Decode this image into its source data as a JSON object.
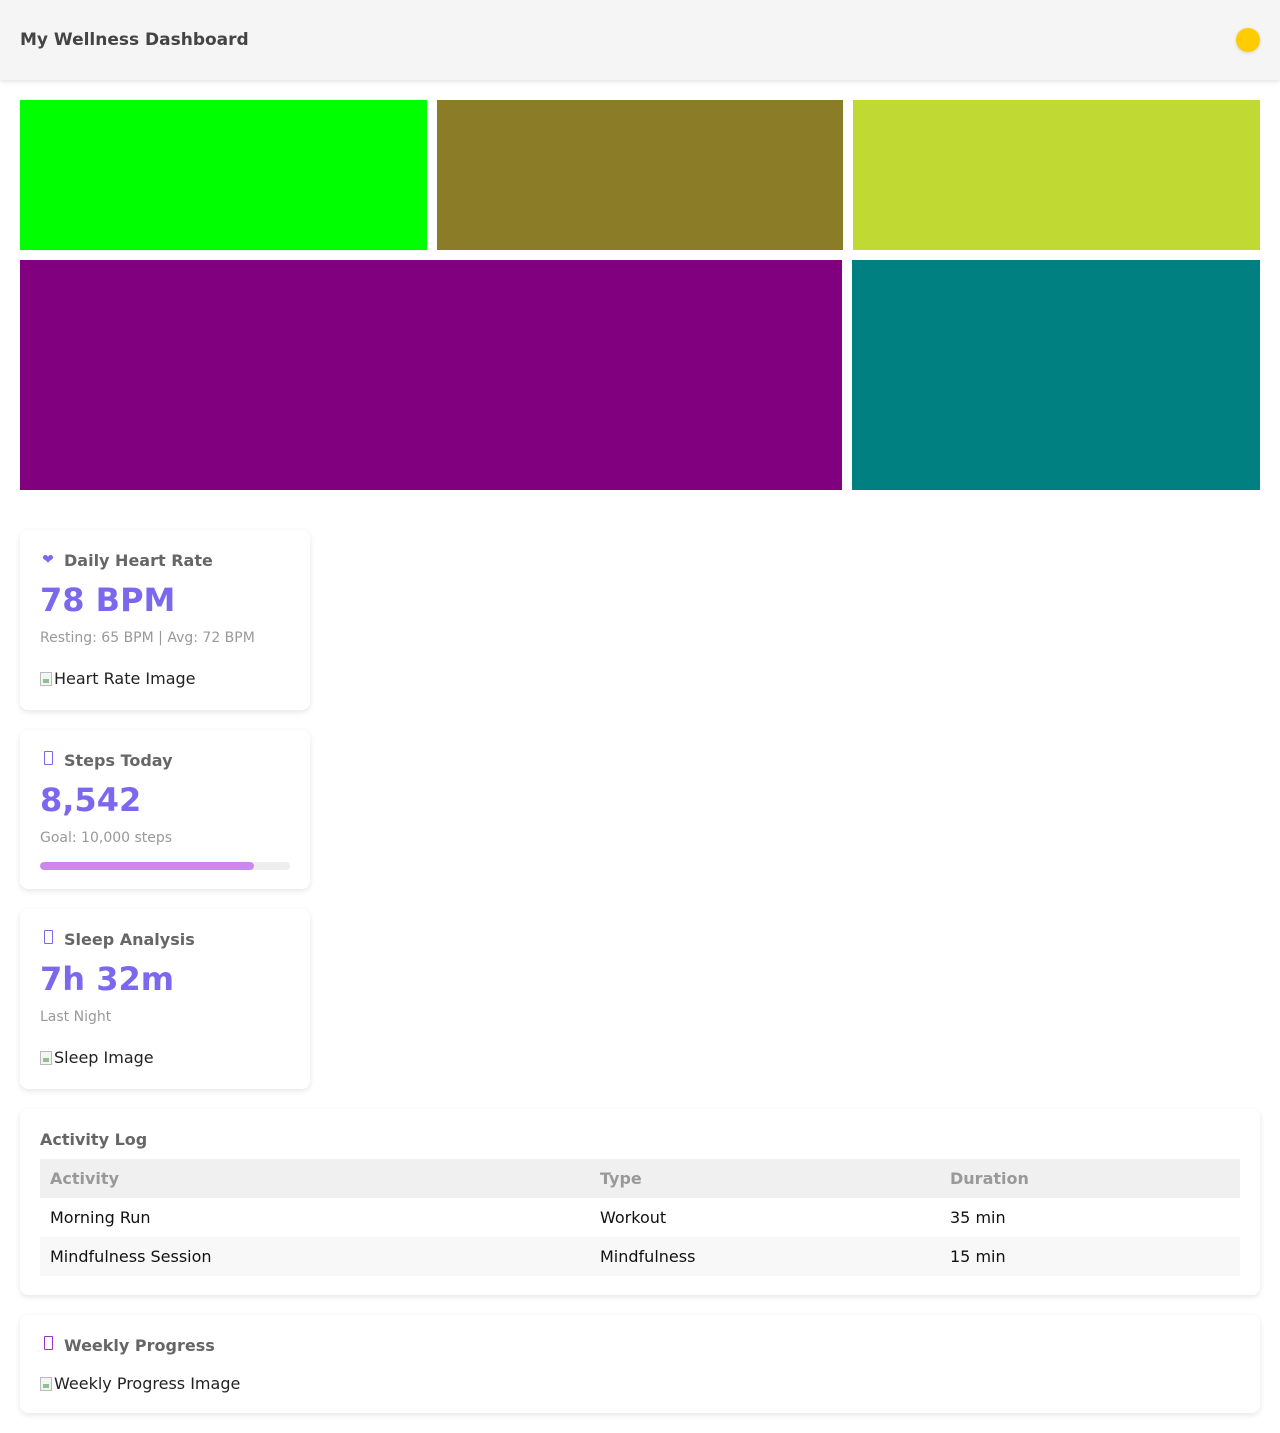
{
  "header": {
    "title": "My Wellness Dashboard",
    "avatar_color": "#ffcc00"
  },
  "tiles": [
    {
      "color": "#00ff00"
    },
    {
      "color": "#8b7d28"
    },
    {
      "color": "#c0d933"
    },
    {
      "color": "#800080"
    },
    {
      "color": "#008080"
    }
  ],
  "heart": {
    "icon": "heart-icon",
    "title": "Daily Heart Rate",
    "value": "78 BPM",
    "detail": "Resting: 65 BPM | Avg: 72 BPM",
    "image_alt": "Heart Rate Image"
  },
  "steps": {
    "icon": "footprints-icon",
    "title": "Steps Today",
    "value": "8,542",
    "goal": "Goal: 10,000 steps",
    "progress": 0.8542
  },
  "sleep": {
    "icon": "moon-icon",
    "title": "Sleep Analysis",
    "value": "7h 32m",
    "detail": "Last Night",
    "image_alt": "Sleep Image"
  },
  "activity_log": {
    "title": "Activity Log",
    "columns": [
      "Activity",
      "Type",
      "Duration"
    ],
    "rows": [
      [
        "Morning Run",
        "Workout",
        "35 min"
      ],
      [
        "Mindfulness Session",
        "Mindfulness",
        "15 min"
      ]
    ]
  },
  "weekly": {
    "icon": "chart-icon",
    "title": "Weekly Progress",
    "image_alt": "Weekly Progress Image"
  },
  "colors": {
    "accent": "#7b68ee",
    "progress_fill": "#cc88ee"
  }
}
